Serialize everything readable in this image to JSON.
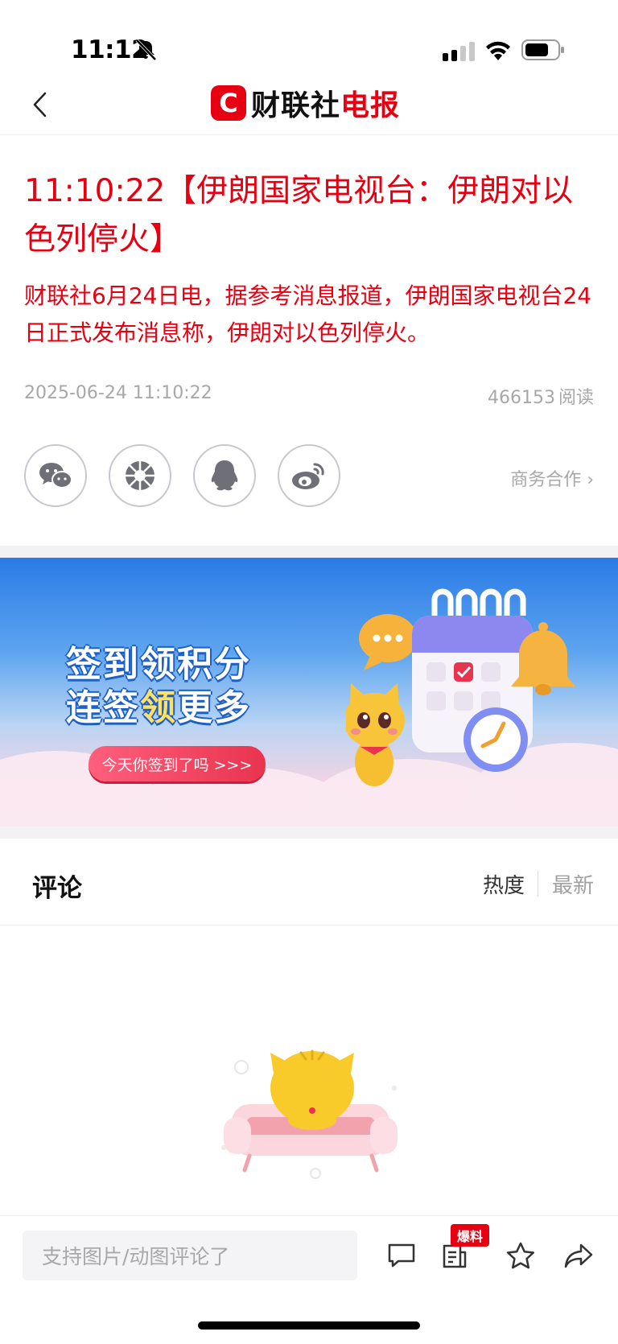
{
  "status_bar": {
    "time": "11:12"
  },
  "nav": {
    "logo_black": "财联社",
    "logo_red": "电报",
    "logo_mark": "C"
  },
  "article": {
    "headline": "11:10:22【伊朗国家电视台：伊朗对以色列停火】",
    "lead": "财联社6月24日电，据参考消息报道，伊朗国家电视台24日正式发布消息称，伊朗对以色列停火。",
    "date": "2025-06-24 11:10:22",
    "reads_count": "466153",
    "reads_label": "阅读",
    "biz_link": "商务合作 ›"
  },
  "share": {
    "icons": [
      "wechat-icon",
      "moments-icon",
      "qq-icon",
      "weibo-icon"
    ]
  },
  "banner": {
    "title_line1": "签到领积分",
    "title_line2a": "连签",
    "title_line2b": "领",
    "title_line2c": "更多",
    "cta": "今天你签到了吗  >>>"
  },
  "comments": {
    "title": "评论",
    "sort_hot": "热度",
    "sort_new": "最新"
  },
  "bottom_bar": {
    "input_placeholder": "支持图片/动图评论了",
    "tip_badge": "爆料"
  },
  "colors": {
    "brand_red": "#e60012",
    "meta_gray": "#a8a8a8",
    "banner_blue": "#2a7be6"
  }
}
